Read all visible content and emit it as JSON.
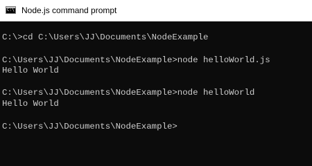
{
  "window": {
    "title": "Node.js command prompt",
    "icon": "command-prompt-icon",
    "icon_glyph": "C:\\"
  },
  "console": {
    "lines": [
      "C:\\>cd C:\\Users\\JJ\\Documents\\NodeExample",
      "C:\\Users\\JJ\\Documents\\NodeExample>node helloWorld.js",
      "Hello World",
      "C:\\Users\\JJ\\Documents\\NodeExample>node helloWorld",
      "Hello World",
      "C:\\Users\\JJ\\Documents\\NodeExample>"
    ]
  },
  "colors": {
    "console_background": "#0c0c0c",
    "console_text": "#cccccc",
    "titlebar_background": "#ffffff"
  }
}
